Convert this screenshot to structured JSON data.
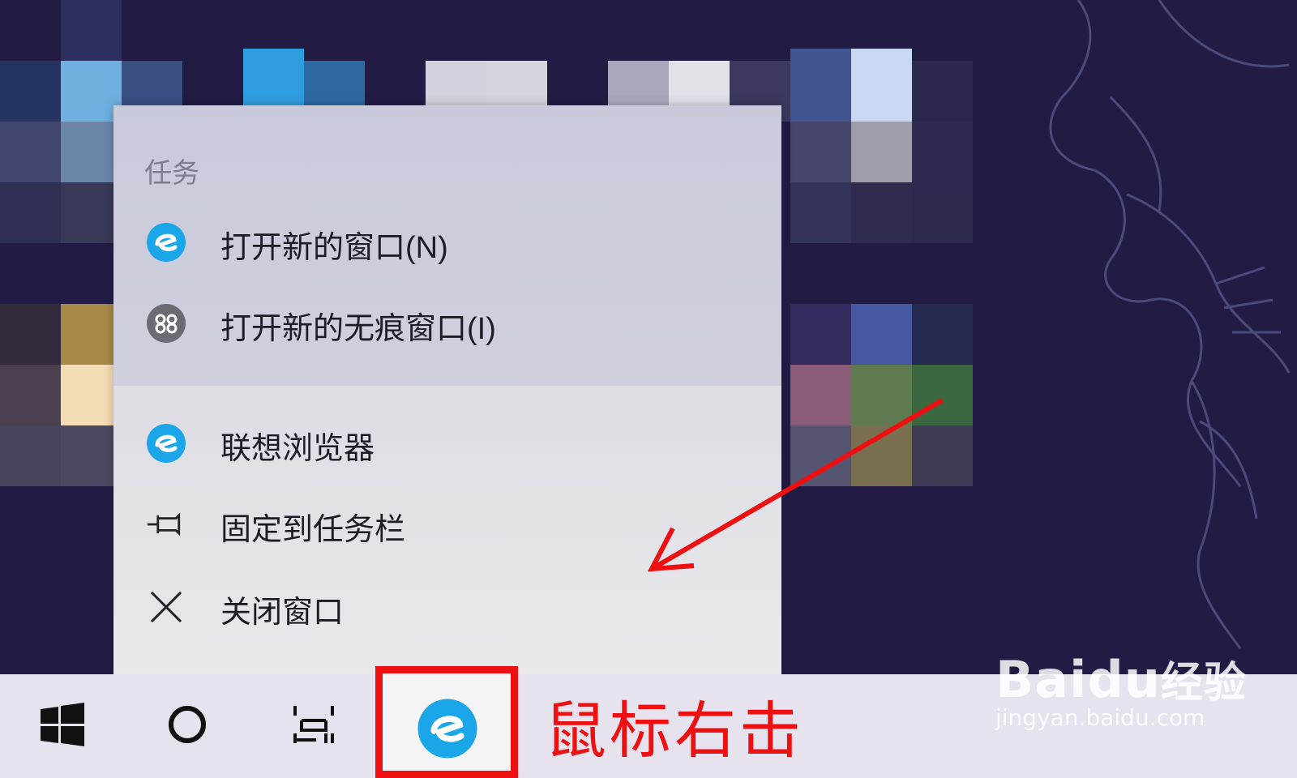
{
  "jumplist": {
    "section_title": "任务",
    "items": [
      {
        "label": "打开新的窗口(N)",
        "icon": "lenovo-browser-icon"
      },
      {
        "label": "打开新的无痕窗口(I)",
        "icon": "incognito-icon"
      },
      {
        "label": "联想浏览器",
        "icon": "lenovo-browser-icon"
      },
      {
        "label": "固定到任务栏",
        "icon": "pin-icon"
      },
      {
        "label": "关闭窗口",
        "icon": "close-icon"
      }
    ]
  },
  "taskbar": {
    "buttons": [
      "windows-start-icon",
      "cortana-search-icon",
      "task-view-icon",
      "lenovo-browser-icon"
    ]
  },
  "annotation": {
    "text": "鼠标右击",
    "color": "#ee1010"
  },
  "watermark": {
    "brand_latin": "Bai",
    "brand_mid": "du",
    "brand_cn": "经验",
    "url": "jingyan.baidu.com"
  },
  "colors": {
    "accent_browser": "#1aa6e8",
    "desktop_bg": "#221c45",
    "taskbar_bg": "#e6e2ee"
  }
}
